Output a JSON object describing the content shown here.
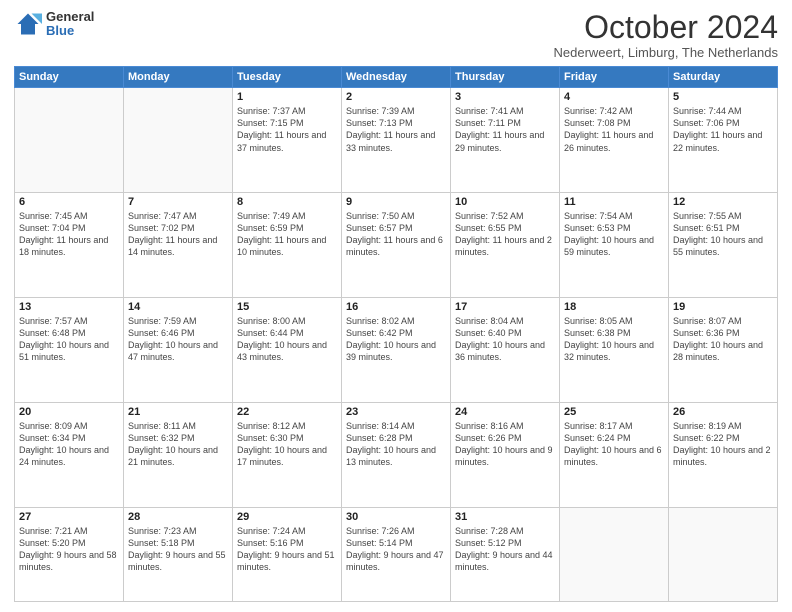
{
  "logo": {
    "general": "General",
    "blue": "Blue"
  },
  "title": "October 2024",
  "subtitle": "Nederweert, Limburg, The Netherlands",
  "days_of_week": [
    "Sunday",
    "Monday",
    "Tuesday",
    "Wednesday",
    "Thursday",
    "Friday",
    "Saturday"
  ],
  "weeks": [
    [
      {
        "day": "",
        "info": ""
      },
      {
        "day": "",
        "info": ""
      },
      {
        "day": "1",
        "info": "Sunrise: 7:37 AM\nSunset: 7:15 PM\nDaylight: 11 hours and 37 minutes."
      },
      {
        "day": "2",
        "info": "Sunrise: 7:39 AM\nSunset: 7:13 PM\nDaylight: 11 hours and 33 minutes."
      },
      {
        "day": "3",
        "info": "Sunrise: 7:41 AM\nSunset: 7:11 PM\nDaylight: 11 hours and 29 minutes."
      },
      {
        "day": "4",
        "info": "Sunrise: 7:42 AM\nSunset: 7:08 PM\nDaylight: 11 hours and 26 minutes."
      },
      {
        "day": "5",
        "info": "Sunrise: 7:44 AM\nSunset: 7:06 PM\nDaylight: 11 hours and 22 minutes."
      }
    ],
    [
      {
        "day": "6",
        "info": "Sunrise: 7:45 AM\nSunset: 7:04 PM\nDaylight: 11 hours and 18 minutes."
      },
      {
        "day": "7",
        "info": "Sunrise: 7:47 AM\nSunset: 7:02 PM\nDaylight: 11 hours and 14 minutes."
      },
      {
        "day": "8",
        "info": "Sunrise: 7:49 AM\nSunset: 6:59 PM\nDaylight: 11 hours and 10 minutes."
      },
      {
        "day": "9",
        "info": "Sunrise: 7:50 AM\nSunset: 6:57 PM\nDaylight: 11 hours and 6 minutes."
      },
      {
        "day": "10",
        "info": "Sunrise: 7:52 AM\nSunset: 6:55 PM\nDaylight: 11 hours and 2 minutes."
      },
      {
        "day": "11",
        "info": "Sunrise: 7:54 AM\nSunset: 6:53 PM\nDaylight: 10 hours and 59 minutes."
      },
      {
        "day": "12",
        "info": "Sunrise: 7:55 AM\nSunset: 6:51 PM\nDaylight: 10 hours and 55 minutes."
      }
    ],
    [
      {
        "day": "13",
        "info": "Sunrise: 7:57 AM\nSunset: 6:48 PM\nDaylight: 10 hours and 51 minutes."
      },
      {
        "day": "14",
        "info": "Sunrise: 7:59 AM\nSunset: 6:46 PM\nDaylight: 10 hours and 47 minutes."
      },
      {
        "day": "15",
        "info": "Sunrise: 8:00 AM\nSunset: 6:44 PM\nDaylight: 10 hours and 43 minutes."
      },
      {
        "day": "16",
        "info": "Sunrise: 8:02 AM\nSunset: 6:42 PM\nDaylight: 10 hours and 39 minutes."
      },
      {
        "day": "17",
        "info": "Sunrise: 8:04 AM\nSunset: 6:40 PM\nDaylight: 10 hours and 36 minutes."
      },
      {
        "day": "18",
        "info": "Sunrise: 8:05 AM\nSunset: 6:38 PM\nDaylight: 10 hours and 32 minutes."
      },
      {
        "day": "19",
        "info": "Sunrise: 8:07 AM\nSunset: 6:36 PM\nDaylight: 10 hours and 28 minutes."
      }
    ],
    [
      {
        "day": "20",
        "info": "Sunrise: 8:09 AM\nSunset: 6:34 PM\nDaylight: 10 hours and 24 minutes."
      },
      {
        "day": "21",
        "info": "Sunrise: 8:11 AM\nSunset: 6:32 PM\nDaylight: 10 hours and 21 minutes."
      },
      {
        "day": "22",
        "info": "Sunrise: 8:12 AM\nSunset: 6:30 PM\nDaylight: 10 hours and 17 minutes."
      },
      {
        "day": "23",
        "info": "Sunrise: 8:14 AM\nSunset: 6:28 PM\nDaylight: 10 hours and 13 minutes."
      },
      {
        "day": "24",
        "info": "Sunrise: 8:16 AM\nSunset: 6:26 PM\nDaylight: 10 hours and 9 minutes."
      },
      {
        "day": "25",
        "info": "Sunrise: 8:17 AM\nSunset: 6:24 PM\nDaylight: 10 hours and 6 minutes."
      },
      {
        "day": "26",
        "info": "Sunrise: 8:19 AM\nSunset: 6:22 PM\nDaylight: 10 hours and 2 minutes."
      }
    ],
    [
      {
        "day": "27",
        "info": "Sunrise: 7:21 AM\nSunset: 5:20 PM\nDaylight: 9 hours and 58 minutes."
      },
      {
        "day": "28",
        "info": "Sunrise: 7:23 AM\nSunset: 5:18 PM\nDaylight: 9 hours and 55 minutes."
      },
      {
        "day": "29",
        "info": "Sunrise: 7:24 AM\nSunset: 5:16 PM\nDaylight: 9 hours and 51 minutes."
      },
      {
        "day": "30",
        "info": "Sunrise: 7:26 AM\nSunset: 5:14 PM\nDaylight: 9 hours and 47 minutes."
      },
      {
        "day": "31",
        "info": "Sunrise: 7:28 AM\nSunset: 5:12 PM\nDaylight: 9 hours and 44 minutes."
      },
      {
        "day": "",
        "info": ""
      },
      {
        "day": "",
        "info": ""
      }
    ]
  ]
}
